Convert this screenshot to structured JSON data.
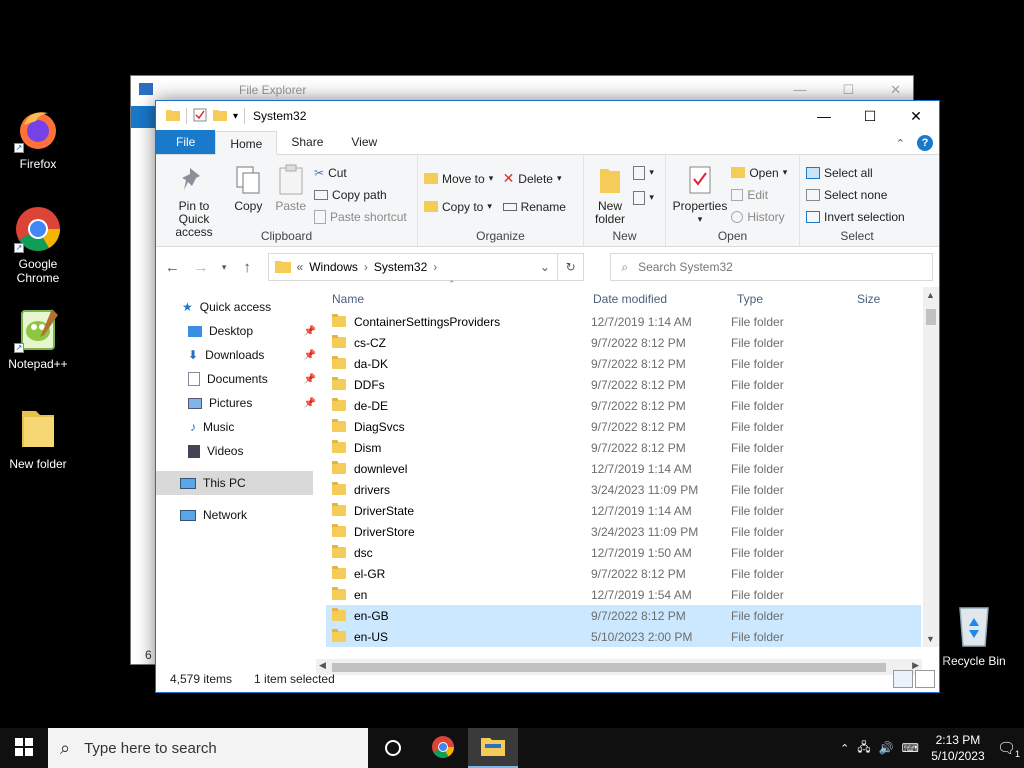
{
  "desktop": {
    "icons": [
      {
        "label": "Firefox"
      },
      {
        "label": "Google Chrome"
      },
      {
        "label": "Notepad++"
      },
      {
        "label": "New folder"
      },
      {
        "label": "Recycle Bin"
      }
    ]
  },
  "bg_window": {
    "title": "File Explorer",
    "status_fragment": "6 i"
  },
  "window": {
    "title": "System32",
    "tabs": {
      "file": "File",
      "home": "Home",
      "share": "Share",
      "view": "View"
    },
    "ribbon": {
      "clipboard": {
        "label": "Clipboard",
        "pin": "Pin to Quick access",
        "copy": "Copy",
        "paste": "Paste",
        "cut": "Cut",
        "copy_path": "Copy path",
        "paste_shortcut": "Paste shortcut"
      },
      "organize": {
        "label": "Organize",
        "move_to": "Move to",
        "copy_to": "Copy to",
        "delete": "Delete",
        "rename": "Rename"
      },
      "new": {
        "label": "New",
        "new_folder": "New folder"
      },
      "open": {
        "label": "Open",
        "properties": "Properties",
        "open": "Open",
        "edit": "Edit",
        "history": "History"
      },
      "select": {
        "label": "Select",
        "select_all": "Select all",
        "select_none": "Select none",
        "invert": "Invert selection"
      }
    },
    "address": {
      "prefix": "«",
      "crumbs": [
        "Windows",
        "System32"
      ]
    },
    "search": {
      "placeholder": "Search System32"
    },
    "nav": {
      "quick_access": "Quick access",
      "desktop": "Desktop",
      "downloads": "Downloads",
      "documents": "Documents",
      "pictures": "Pictures",
      "music": "Music",
      "videos": "Videos",
      "this_pc": "This PC",
      "network": "Network"
    },
    "columns": {
      "name": "Name",
      "date": "Date modified",
      "type": "Type",
      "size": "Size"
    },
    "files": [
      {
        "name": "ContainerSettingsProviders",
        "date": "12/7/2019 1:14 AM",
        "type": "File folder"
      },
      {
        "name": "cs-CZ",
        "date": "9/7/2022 8:12 PM",
        "type": "File folder"
      },
      {
        "name": "da-DK",
        "date": "9/7/2022 8:12 PM",
        "type": "File folder"
      },
      {
        "name": "DDFs",
        "date": "9/7/2022 8:12 PM",
        "type": "File folder"
      },
      {
        "name": "de-DE",
        "date": "9/7/2022 8:12 PM",
        "type": "File folder"
      },
      {
        "name": "DiagSvcs",
        "date": "9/7/2022 8:12 PM",
        "type": "File folder"
      },
      {
        "name": "Dism",
        "date": "9/7/2022 8:12 PM",
        "type": "File folder"
      },
      {
        "name": "downlevel",
        "date": "12/7/2019 1:14 AM",
        "type": "File folder"
      },
      {
        "name": "drivers",
        "date": "3/24/2023 11:09 PM",
        "type": "File folder"
      },
      {
        "name": "DriverState",
        "date": "12/7/2019 1:14 AM",
        "type": "File folder"
      },
      {
        "name": "DriverStore",
        "date": "3/24/2023 11:09 PM",
        "type": "File folder"
      },
      {
        "name": "dsc",
        "date": "12/7/2019 1:50 AM",
        "type": "File folder"
      },
      {
        "name": "el-GR",
        "date": "9/7/2022 8:12 PM",
        "type": "File folder"
      },
      {
        "name": "en",
        "date": "12/7/2019 1:54 AM",
        "type": "File folder"
      },
      {
        "name": "en-GB",
        "date": "9/7/2022 8:12 PM",
        "type": "File folder"
      },
      {
        "name": "en-US",
        "date": "5/10/2023 2:00 PM",
        "type": "File folder"
      }
    ],
    "selected_rows": [
      14,
      15
    ],
    "status": {
      "items": "4,579 items",
      "selected": "1 item selected"
    }
  },
  "taskbar": {
    "search_placeholder": "Type here to search",
    "time": "2:13 PM",
    "date": "5/10/2023",
    "notif_count": "1"
  }
}
